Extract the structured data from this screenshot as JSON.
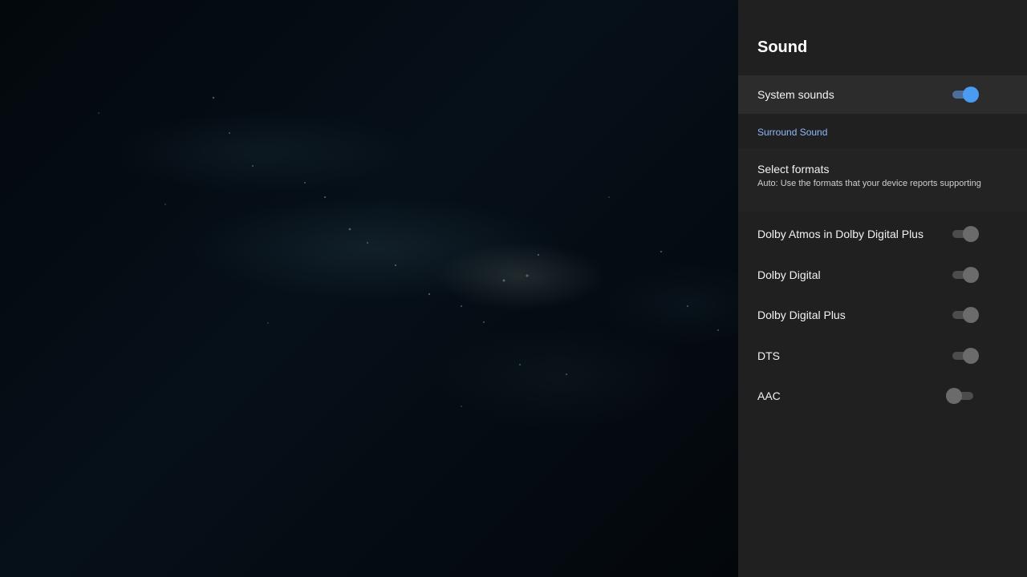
{
  "colors": {
    "panel_background": "#202020",
    "focused_row": "#2c2c2c",
    "section_header": "#8fb9ff",
    "toggle_active": "#4a9cf2",
    "toggle_inactive": "#6b6b6b"
  },
  "panel": {
    "title": "Sound"
  },
  "system_sounds": {
    "label": "System sounds",
    "enabled": true
  },
  "surround_sound": {
    "header": "Surround Sound",
    "select_formats": {
      "label": "Select formats",
      "subtitle": "Auto: Use the formats that your device reports supporting"
    },
    "formats": [
      {
        "label": "Dolby Atmos in Dolby Digital Plus",
        "enabled": true
      },
      {
        "label": "Dolby Digital",
        "enabled": true
      },
      {
        "label": "Dolby Digital Plus",
        "enabled": true
      },
      {
        "label": "DTS",
        "enabled": true
      },
      {
        "label": "AAC",
        "enabled": false
      }
    ]
  }
}
